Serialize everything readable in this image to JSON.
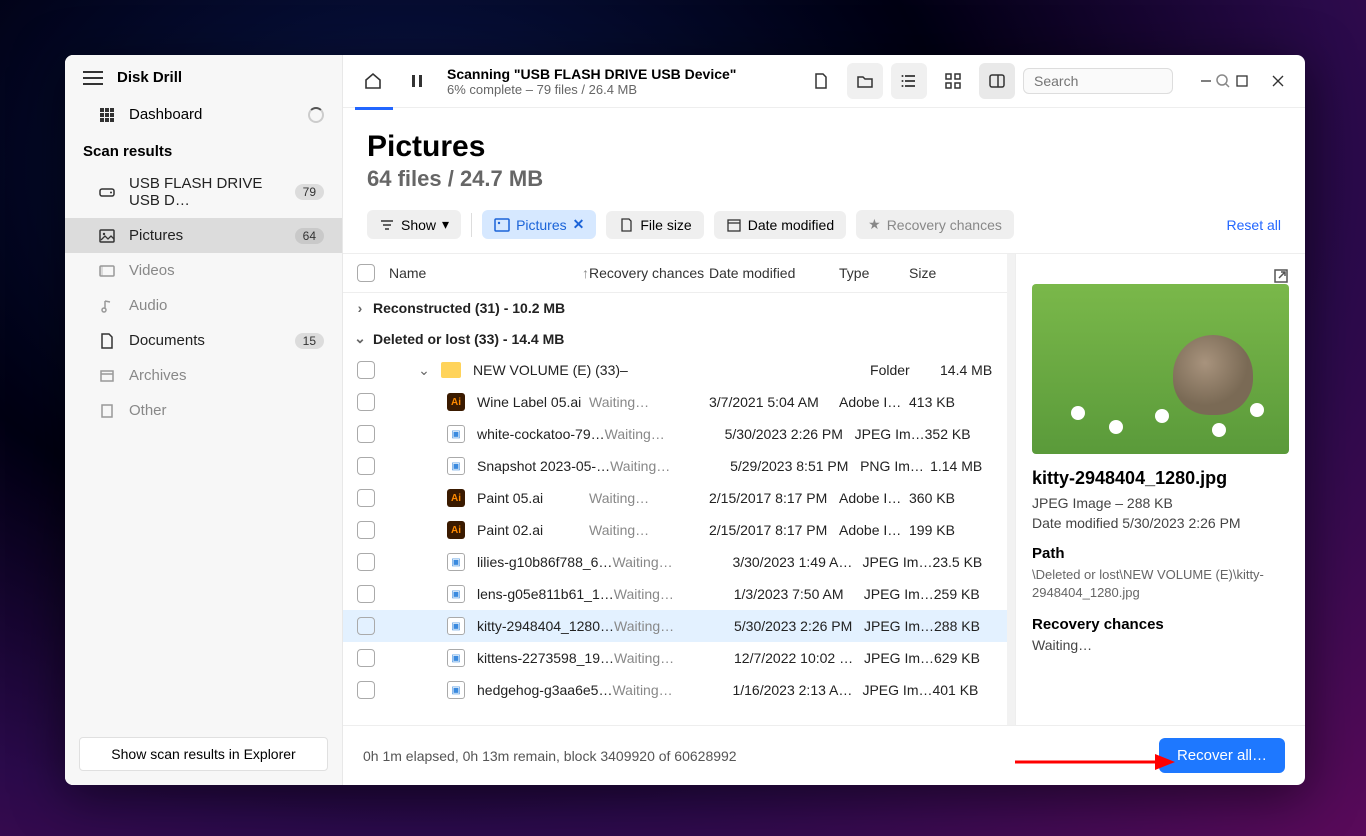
{
  "app_title": "Disk Drill",
  "sidebar": {
    "dashboard": "Dashboard",
    "section_header": "Scan results",
    "items": [
      {
        "label": "USB FLASH DRIVE USB D…",
        "badge": "79",
        "icon": "drive-icon"
      },
      {
        "label": "Pictures",
        "badge": "64",
        "icon": "picture-icon",
        "active": true
      },
      {
        "label": "Videos",
        "icon": "video-icon"
      },
      {
        "label": "Audio",
        "icon": "audio-icon"
      },
      {
        "label": "Documents",
        "badge": "15",
        "icon": "document-icon"
      },
      {
        "label": "Archives",
        "icon": "archive-icon"
      },
      {
        "label": "Other",
        "icon": "other-icon"
      }
    ],
    "explorer_btn": "Show scan results in Explorer"
  },
  "topbar": {
    "scan_title": "Scanning \"USB FLASH DRIVE USB Device\"",
    "scan_sub": "6% complete – 79 files / 26.4 MB",
    "search_placeholder": "Search"
  },
  "heading": {
    "title": "Pictures",
    "sub": "64 files / 24.7 MB"
  },
  "filters": {
    "show": "Show",
    "pictures": "Pictures",
    "file_size": "File size",
    "date_modified": "Date modified",
    "recovery_chances": "Recovery chances",
    "reset": "Reset all"
  },
  "columns": {
    "name": "Name",
    "rec": "Recovery chances",
    "date": "Date modified",
    "type": "Type",
    "size": "Size"
  },
  "groups": [
    {
      "label": "Reconstructed (31) - 10.2 MB",
      "expanded": false
    },
    {
      "label": "Deleted or lost (33) - 14.4 MB",
      "expanded": true
    }
  ],
  "folder_row": {
    "name": "NEW VOLUME (E) (33)",
    "rec": "–",
    "type": "Folder",
    "size": "14.4 MB"
  },
  "files": [
    {
      "icon": "ai",
      "name": "Wine Label 05.ai",
      "rec": "Waiting…",
      "date": "3/7/2021 5:04 AM",
      "type": "Adobe I…",
      "size": "413 KB"
    },
    {
      "icon": "img",
      "name": "white-cockatoo-79…",
      "rec": "Waiting…",
      "date": "5/30/2023 2:26 PM",
      "type": "JPEG Im…",
      "size": "352 KB"
    },
    {
      "icon": "img",
      "name": "Snapshot 2023-05-…",
      "rec": "Waiting…",
      "date": "5/29/2023 8:51 PM",
      "type": "PNG Im…",
      "size": "1.14 MB"
    },
    {
      "icon": "ai",
      "name": "Paint 05.ai",
      "rec": "Waiting…",
      "date": "2/15/2017 8:17 PM",
      "type": "Adobe I…",
      "size": "360 KB"
    },
    {
      "icon": "ai",
      "name": "Paint 02.ai",
      "rec": "Waiting…",
      "date": "2/15/2017 8:17 PM",
      "type": "Adobe I…",
      "size": "199 KB"
    },
    {
      "icon": "img",
      "name": "lilies-g10b86f788_6…",
      "rec": "Waiting…",
      "date": "3/30/2023 1:49 A…",
      "type": "JPEG Im…",
      "size": "23.5 KB"
    },
    {
      "icon": "img",
      "name": "lens-g05e811b61_1…",
      "rec": "Waiting…",
      "date": "1/3/2023 7:50 AM",
      "type": "JPEG Im…",
      "size": "259 KB"
    },
    {
      "icon": "img",
      "name": "kitty-2948404_1280…",
      "rec": "Waiting…",
      "date": "5/30/2023 2:26 PM",
      "type": "JPEG Im…",
      "size": "288 KB",
      "selected": true
    },
    {
      "icon": "img",
      "name": "kittens-2273598_19…",
      "rec": "Waiting…",
      "date": "12/7/2022 10:02 …",
      "type": "JPEG Im…",
      "size": "629 KB"
    },
    {
      "icon": "img",
      "name": "hedgehog-g3aa6e5…",
      "rec": "Waiting…",
      "date": "1/16/2023 2:13 A…",
      "type": "JPEG Im…",
      "size": "401 KB"
    }
  ],
  "preview": {
    "filename": "kitty-2948404_1280.jpg",
    "meta": "JPEG Image – 288 KB",
    "modified": "Date modified 5/30/2023 2:26 PM",
    "path_h": "Path",
    "path": "\\Deleted or lost\\NEW VOLUME (E)\\kitty-2948404_1280.jpg",
    "rec_h": "Recovery chances",
    "rec": "Waiting…"
  },
  "footer": {
    "status": "0h 1m elapsed, 0h 13m remain, block 3409920 of 60628992",
    "recover": "Recover all…"
  }
}
